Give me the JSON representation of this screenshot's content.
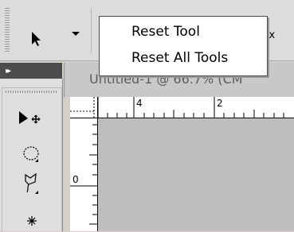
{
  "menu": {
    "items": [
      {
        "label": "Reset Tool"
      },
      {
        "label": "Reset All Tools"
      }
    ]
  },
  "options_bar": {
    "partial_text": "ox"
  },
  "document": {
    "title": "Untitled-1 @ 66.7% (CM"
  },
  "rulers": {
    "horizontal_labels": [
      "4",
      "2"
    ],
    "vertical_labels": [
      "0"
    ]
  },
  "tools": [
    "move-tool",
    "ellipse-marquee-tool",
    "lasso-tool",
    "magic-wand-tool"
  ]
}
